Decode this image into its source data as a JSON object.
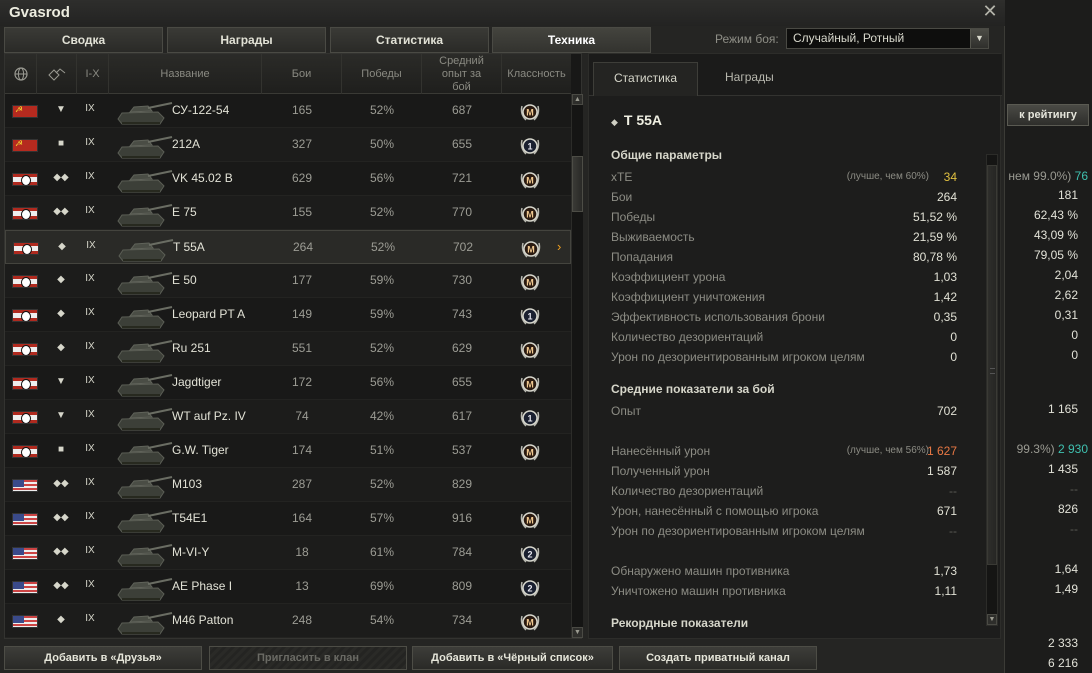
{
  "window": {
    "title": "Gvasrod",
    "close_glyph": "✕"
  },
  "tabs": [
    {
      "label": "Сводка"
    },
    {
      "label": "Награды"
    },
    {
      "label": "Статистика"
    },
    {
      "label": "Техника",
      "active": true
    }
  ],
  "battle_mode": {
    "label": "Режим боя:",
    "value": "Случайный, Ротный"
  },
  "vehicle_table": {
    "columns": {
      "nation_icon": "globe-icon",
      "type_icon": "vehicle-type-icon",
      "tier": "I-X",
      "name": "Название",
      "battles": "Бои",
      "wins": "Победы",
      "avg_xp": "Средний опыт за бой",
      "mastery": "Классность"
    },
    "rows": [
      {
        "nation": "ussr",
        "type": "▼",
        "tier": "IX",
        "name": "СУ-122-54",
        "battles": "165",
        "wins": "52%",
        "xp": "687",
        "badge": "M"
      },
      {
        "nation": "ussr",
        "type": "■",
        "tier": "IX",
        "name": "212А",
        "battles": "327",
        "wins": "50%",
        "xp": "655",
        "badge": "1"
      },
      {
        "nation": "germany",
        "type": "◆◆",
        "tier": "IX",
        "name": "VK 45.02 B",
        "battles": "629",
        "wins": "56%",
        "xp": "721",
        "badge": "M"
      },
      {
        "nation": "germany",
        "type": "◆◆",
        "tier": "IX",
        "name": "E 75",
        "battles": "155",
        "wins": "52%",
        "xp": "770",
        "badge": "M"
      },
      {
        "nation": "germany",
        "type": "◆",
        "tier": "IX",
        "name": "T 55A",
        "battles": "264",
        "wins": "52%",
        "xp": "702",
        "badge": "M",
        "selected": true
      },
      {
        "nation": "germany",
        "type": "◆",
        "tier": "IX",
        "name": "E 50",
        "battles": "177",
        "wins": "59%",
        "xp": "730",
        "badge": "M"
      },
      {
        "nation": "germany",
        "type": "◆",
        "tier": "IX",
        "name": "Leopard PT A",
        "battles": "149",
        "wins": "59%",
        "xp": "743",
        "badge": "1"
      },
      {
        "nation": "germany",
        "type": "◆",
        "tier": "IX",
        "name": "Ru 251",
        "battles": "551",
        "wins": "52%",
        "xp": "629",
        "badge": "M"
      },
      {
        "nation": "germany",
        "type": "▼",
        "tier": "IX",
        "name": "Jagdtiger",
        "battles": "172",
        "wins": "56%",
        "xp": "655",
        "badge": "M"
      },
      {
        "nation": "germany",
        "type": "▼",
        "tier": "IX",
        "name": "WT auf Pz. IV",
        "battles": "74",
        "wins": "42%",
        "xp": "617",
        "badge": "1"
      },
      {
        "nation": "germany",
        "type": "■",
        "tier": "IX",
        "name": "G.W. Tiger",
        "battles": "174",
        "wins": "51%",
        "xp": "537",
        "badge": "M"
      },
      {
        "nation": "usa",
        "type": "◆◆",
        "tier": "IX",
        "name": "M103",
        "battles": "287",
        "wins": "52%",
        "xp": "829",
        "badge": ""
      },
      {
        "nation": "usa",
        "type": "◆◆",
        "tier": "IX",
        "name": "T54E1",
        "battles": "164",
        "wins": "57%",
        "xp": "916",
        "badge": "M"
      },
      {
        "nation": "usa",
        "type": "◆◆",
        "tier": "IX",
        "name": "M-VI-Y",
        "battles": "18",
        "wins": "61%",
        "xp": "784",
        "badge": "2"
      },
      {
        "nation": "usa",
        "type": "◆◆",
        "tier": "IX",
        "name": "AE Phase I",
        "battles": "13",
        "wins": "69%",
        "xp": "809",
        "badge": "2"
      },
      {
        "nation": "usa",
        "type": "◆",
        "tier": "IX",
        "name": "M46 Patton",
        "battles": "248",
        "wins": "54%",
        "xp": "734",
        "badge": "M"
      }
    ]
  },
  "detail": {
    "tabs": [
      {
        "label": "Статистика",
        "active": true
      },
      {
        "label": "Награды"
      }
    ],
    "tank_name": "T 55A",
    "sections": [
      {
        "title": "Общие параметры",
        "rows": [
          {
            "label": "xTE",
            "note": "(лучше, чем 60%)",
            "value": "34",
            "color": "y"
          },
          {
            "label": "Бои",
            "value": "264"
          },
          {
            "label": "Победы",
            "value": "51,52 %"
          },
          {
            "label": "Выживаемость",
            "value": "21,59 %"
          },
          {
            "label": "Попадания",
            "value": "80,78 %"
          },
          {
            "label": "Коэффициент урона",
            "value": "1,03"
          },
          {
            "label": "Коэффициент уничтожения",
            "value": "1,42"
          },
          {
            "label": "Эффективность использования брони",
            "value": "0,35"
          },
          {
            "label": "Количество дезориентаций",
            "value": "0"
          },
          {
            "label": "Урон по дезориентированным игроком целям",
            "value": "0"
          }
        ]
      },
      {
        "title": "Средние показатели за бой",
        "rows": [
          {
            "label": "Опыт",
            "value": "702"
          },
          {
            "label": "",
            "value": ""
          },
          {
            "label": "Нанесённый урон",
            "note": "(лучше, чем 56%)",
            "value": "1 627",
            "color": "o"
          },
          {
            "label": "Полученный урон",
            "value": "1 587"
          },
          {
            "label": "Количество дезориентаций",
            "value": "--",
            "color": "d"
          },
          {
            "label": "Урон, нанесённый с помощью игрока",
            "value": "671"
          },
          {
            "label": "Урон по дезориентированным игроком целям",
            "value": "--",
            "color": "d"
          },
          {
            "label": "",
            "value": ""
          },
          {
            "label": "Обнаружено машин противника",
            "value": "1,73"
          },
          {
            "label": "Уничтожено машин противника",
            "value": "1,11"
          }
        ]
      },
      {
        "title": "Рекордные показатели",
        "rows": []
      }
    ]
  },
  "footer": {
    "buttons": [
      {
        "label": "Добавить в «Друзья»",
        "enabled": true
      },
      {
        "label": "Пригласить в клан",
        "enabled": false
      },
      {
        "label": "Добавить в «Чёрный список»",
        "enabled": true
      },
      {
        "label": "Создать приватный канал",
        "enabled": true
      }
    ]
  },
  "background_panel": {
    "rating_button": "к рейтингу",
    "values": [
      {
        "text": "нем 99.0%)",
        "accent": "76"
      },
      {
        "text": "181"
      },
      {
        "text": "62,43 %"
      },
      {
        "text": "43,09 %"
      },
      {
        "text": "79,05 %"
      },
      {
        "text": "2,04"
      },
      {
        "text": "2,62"
      },
      {
        "text": "0,31"
      },
      {
        "text": "0"
      },
      {
        "text": "0"
      },
      {
        "text": "1 165"
      },
      {
        "text": "99.3%)",
        "accent": "2 930"
      },
      {
        "text": "1 435"
      },
      {
        "text": "--"
      },
      {
        "text": "826"
      },
      {
        "text": "--"
      },
      {
        "text": "1,64"
      },
      {
        "text": "1,49"
      },
      {
        "text": "2 333"
      },
      {
        "text": "6 216"
      }
    ]
  }
}
